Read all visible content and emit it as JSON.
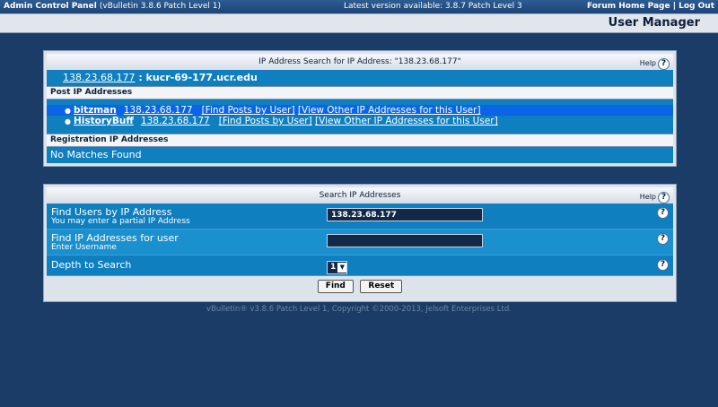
{
  "topbar": {
    "app_title": "Admin Control Panel",
    "app_version": "(vBulletin 3.8.6 Patch Level 1)",
    "latest_version": "Latest version available: 3.8.7 Patch Level 3",
    "forum_home": "Forum Home Page",
    "separator": " | ",
    "logout": "Log Out"
  },
  "page_title": "User Manager",
  "ip_panel": {
    "title": "IP Address Search for IP Address: \"138.23.68.177\"",
    "help": "Help",
    "ip": "138.23.68.177",
    "host_sep": " : ",
    "hostname": "kucr-69-177.ucr.edu",
    "post_ip_header": "Post IP Addresses",
    "post_ips": [
      {
        "user": "bitzman",
        "ip": "138.23.68.177",
        "find_posts": "[Find Posts by User]",
        "view_other": "[View Other IP Addresses for this User]"
      },
      {
        "user": "HistoryBuff",
        "ip": "138.23.68.177",
        "find_posts": "[Find Posts by User]",
        "view_other": "[View Other IP Addresses for this User]"
      }
    ],
    "reg_ip_header": "Registration IP Addresses",
    "no_matches": "No Matches Found"
  },
  "search_panel": {
    "title": "Search IP Addresses",
    "help": "Help",
    "rows": {
      "find_users": {
        "label": "Find Users by IP Address",
        "sub": "You may enter a partial IP Address",
        "value": "138.23.68.177"
      },
      "find_ips": {
        "label": "Find IP Addresses for user",
        "sub": "Enter Username",
        "value": ""
      },
      "depth": {
        "label": "Depth to Search",
        "value": "1"
      }
    },
    "find_button": "Find",
    "reset_button": "Reset"
  },
  "copyright": "vBulletin® v3.8.6 Patch Level 1, Copyright ©2000-2013, Jelsoft Enterprises Ltd.",
  "colors": {
    "background": "#1b3c66",
    "row": "#0f7fbf",
    "highlight": "#0a64e8"
  }
}
